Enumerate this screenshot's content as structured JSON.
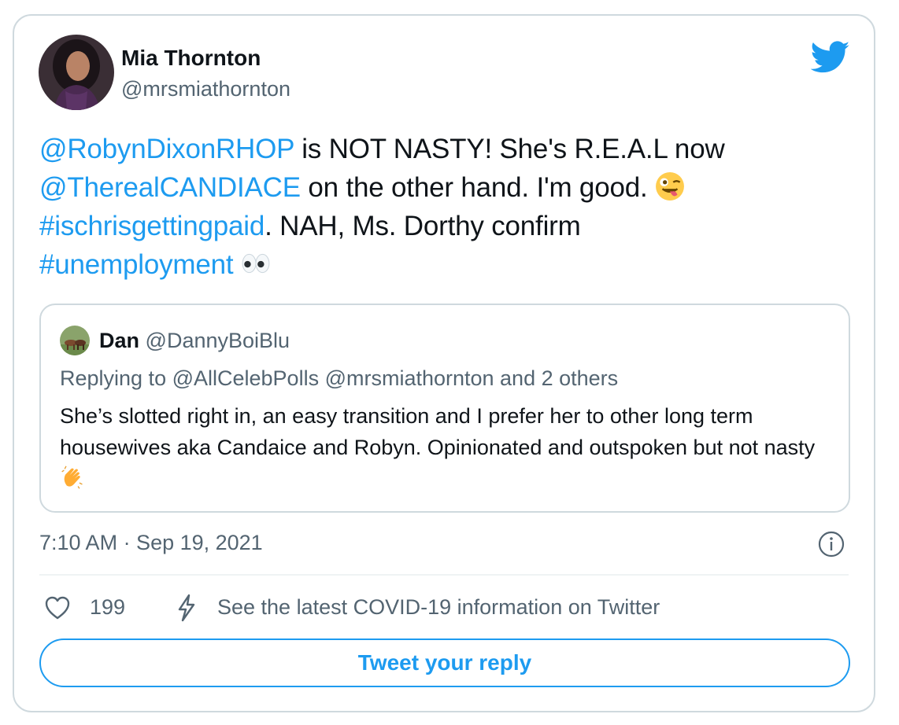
{
  "tweet": {
    "author": {
      "name": "Mia Thornton",
      "handle": "@mrsmiathornton"
    },
    "text": {
      "mention1": "@RobynDixonRHOP",
      "seg1": " is NOT NASTY!  She's R.E.A.L now ",
      "mention2": "@TherealCANDIACE",
      "seg2": " on the other hand.  I'm good. ",
      "hashtag1": "#ischrisgettingpaid",
      "seg3": ". NAH,  Ms. Dorthy confirm ",
      "hashtag2": "#unemployment",
      "emoji1": "winking-face-with-tongue",
      "emoji2": "eyes"
    },
    "timestamp": "7:10 AM · Sep 19, 2021",
    "likes": "199",
    "covid_link": "See the latest COVID-19 information on Twitter",
    "reply_button": "Tweet your reply"
  },
  "quoted": {
    "name": "Dan",
    "handle": "@DannyBoiBlu",
    "replying": "Replying to @AllCelebPolls @mrsmiathornton and 2 others",
    "text": "She’s slotted right in, an easy transition and I prefer her to other long term housewives aka Candaice and Robyn. Opinionated and outspoken but not nasty ",
    "emoji": "clapping-hands"
  },
  "colors": {
    "accent": "#1d9bf0",
    "secondary_text": "#536471",
    "border": "#cfd9de"
  }
}
